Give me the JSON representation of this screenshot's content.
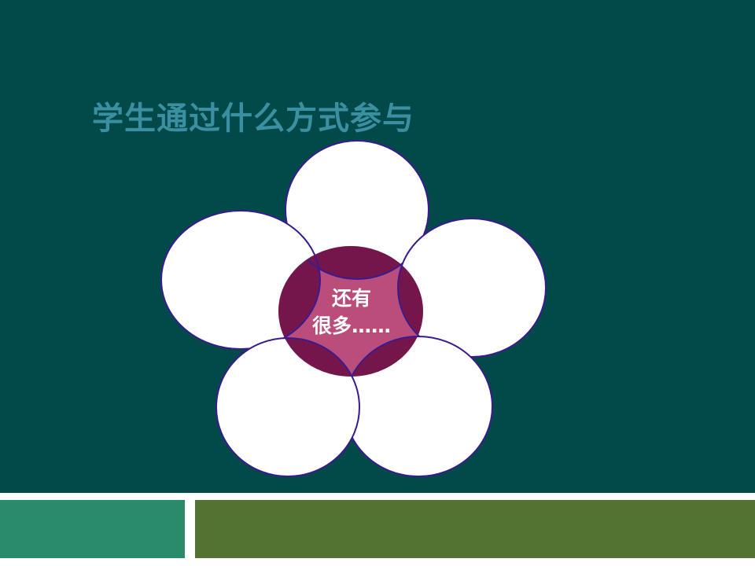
{
  "title": "学生通过什么方式参与",
  "center": {
    "line1": "还有",
    "line2": "很多……"
  },
  "colors": {
    "background": "#02494a",
    "title": "#3a8fa0",
    "petal_fill": "#ffffff",
    "petal_stroke": "#3a1b8f",
    "center_fill": "#bb4d7a",
    "center_overlap": "#74164b",
    "bar_left": "#2a8a6c",
    "bar_right": "#537332"
  }
}
